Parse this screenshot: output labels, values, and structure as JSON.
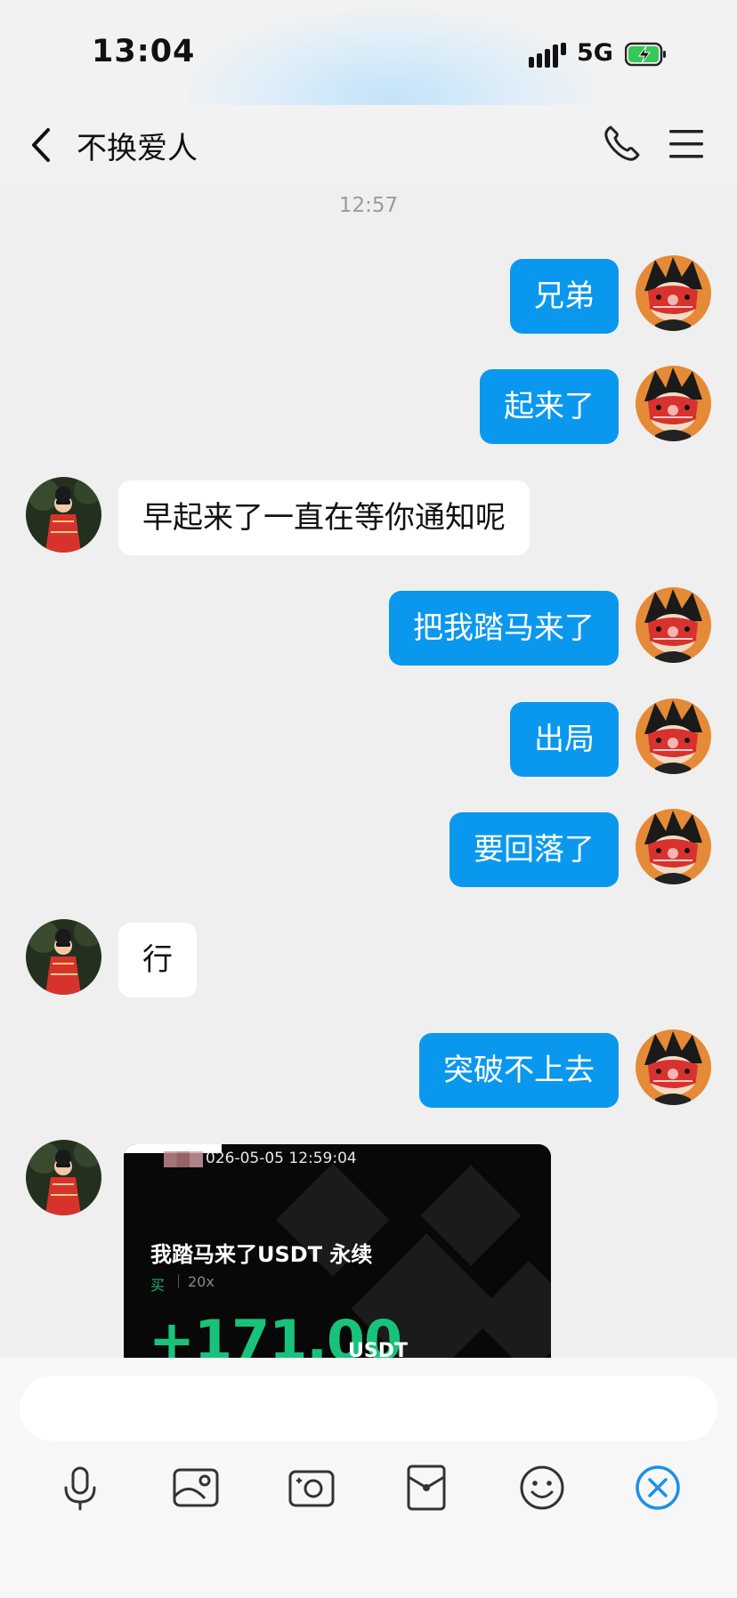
{
  "status_bar": {
    "time": "13:04",
    "network": "5G"
  },
  "header": {
    "title": "不换爱人"
  },
  "chat": {
    "timestamp": "12:57",
    "messages": [
      {
        "side": "out",
        "text": "兄弟"
      },
      {
        "side": "out",
        "text": "起来了"
      },
      {
        "side": "in",
        "text": "早起来了一直在等你通知呢"
      },
      {
        "side": "out",
        "text": "把我踏马来了"
      },
      {
        "side": "out",
        "text": "出局"
      },
      {
        "side": "out",
        "text": "要回落了"
      },
      {
        "side": "in",
        "text": "行"
      },
      {
        "side": "out",
        "text": "突破不上去"
      }
    ],
    "image_card": {
      "datetime": "026-05-05 12:59:04",
      "pair": "我踏马来了USDT 永续",
      "side": "买",
      "leverage": "20x",
      "pnl": "+171.00",
      "unit": "USDT"
    }
  },
  "toolbar": {
    "items": [
      "mic-icon",
      "image-icon",
      "camera-icon",
      "red-packet-icon",
      "emoji-icon",
      "close-icon"
    ]
  },
  "colors": {
    "outgoing_bubble": "#0a98ef",
    "incoming_bubble": "#ffffff",
    "pnl_green": "#19c27a",
    "accent": "#1e90e8"
  }
}
